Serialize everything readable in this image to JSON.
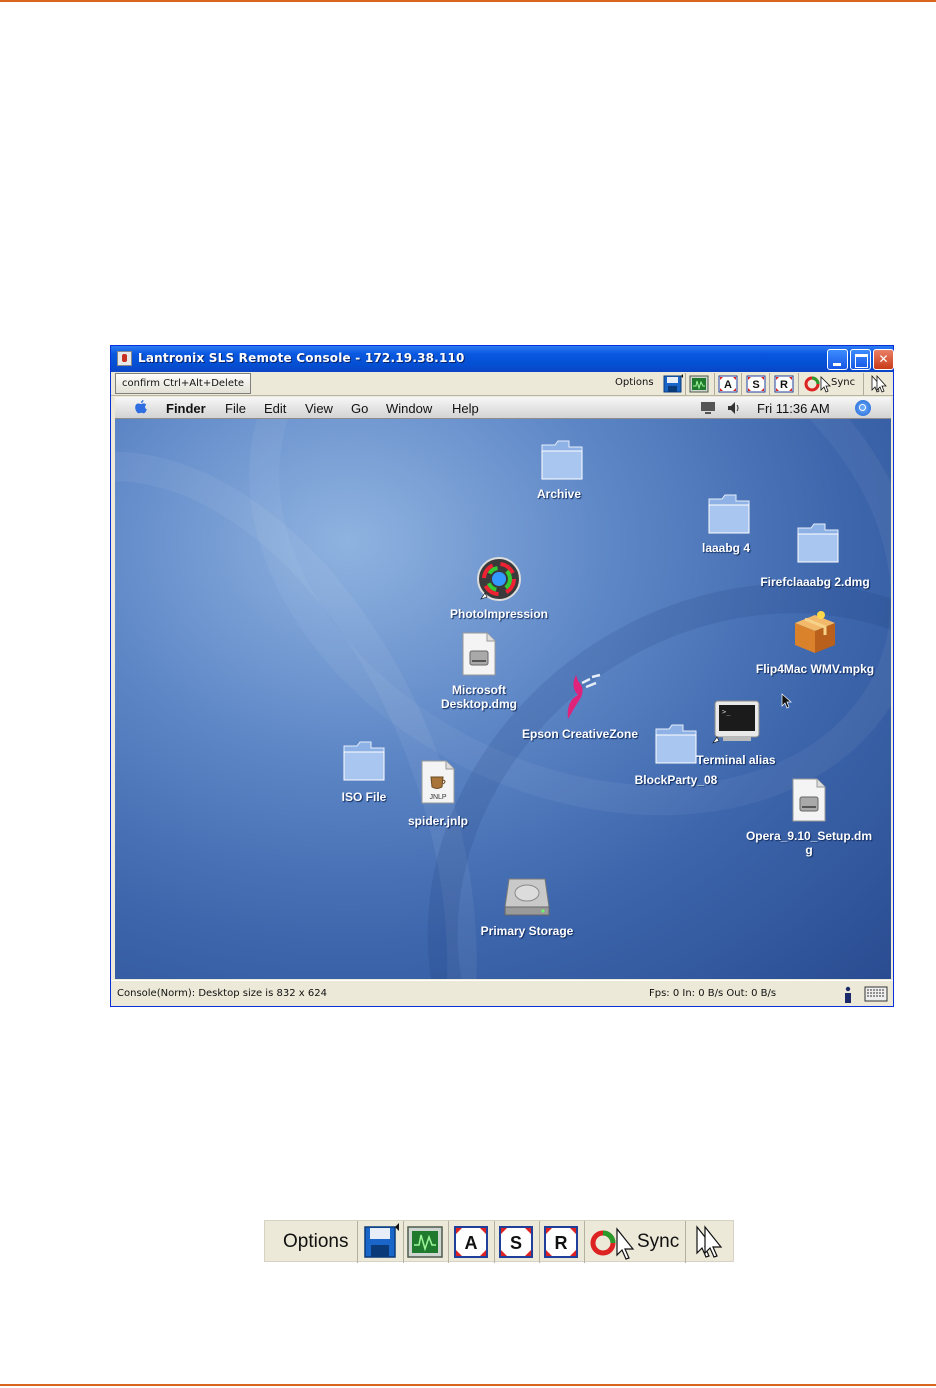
{
  "window": {
    "title": "Lantronix SLS Remote Console - 172.19.38.110"
  },
  "toolbar": {
    "cad_button": "confirm Ctrl+Alt+Delete",
    "options_label": "Options",
    "sync_label": "Sync"
  },
  "mac_menubar": {
    "items": [
      "Finder",
      "File",
      "Edit",
      "View",
      "Go",
      "Window",
      "Help"
    ],
    "clock": "Fri 11:36 AM"
  },
  "desktop_icons": [
    {
      "label": "Archive",
      "icon": "folder-icon"
    },
    {
      "label": "laaabg 4",
      "icon": "folder-icon"
    },
    {
      "label": "Firefclaaabg 2.dmg",
      "icon": "folder-icon"
    },
    {
      "label": "PhotoImpression",
      "icon": "photoimpression-app-icon"
    },
    {
      "label": "Flip4Mac WMV.mpkg",
      "icon": "package-icon"
    },
    {
      "label": "Microsoft",
      "label2": "Desktop.dmg",
      "icon": "disk-image-icon"
    },
    {
      "label": "Epson CreativeZone",
      "icon": "epson-app-icon"
    },
    {
      "label": "Terminal alias",
      "icon": "terminal-icon"
    },
    {
      "label": "BlockParty_08",
      "icon": "folder-icon"
    },
    {
      "label": "ISO File",
      "icon": "folder-icon"
    },
    {
      "label": "spider.jnlp",
      "icon": "jnlp-file-icon",
      "badge": "JNLP"
    },
    {
      "label": "Opera_9.10_Setup.dm",
      "label2": "g",
      "icon": "disk-image-icon"
    },
    {
      "label": "Primary Storage",
      "icon": "hard-drive-icon"
    }
  ],
  "statusbar": {
    "left": "Console(Norm): Desktop size is 832 x 624",
    "right": "Fps: 0 In: 0 B/s Out: 0 B/s"
  },
  "zoomed_toolbar": {
    "options_label": "Options",
    "sync_label": "Sync",
    "button_letters": [
      "A",
      "S",
      "R"
    ]
  },
  "colors": {
    "rule": "#d9651e",
    "titlebar": "#0a58e0",
    "toolbar_bg": "#ece9d8",
    "desktop": "#4a74b8"
  }
}
